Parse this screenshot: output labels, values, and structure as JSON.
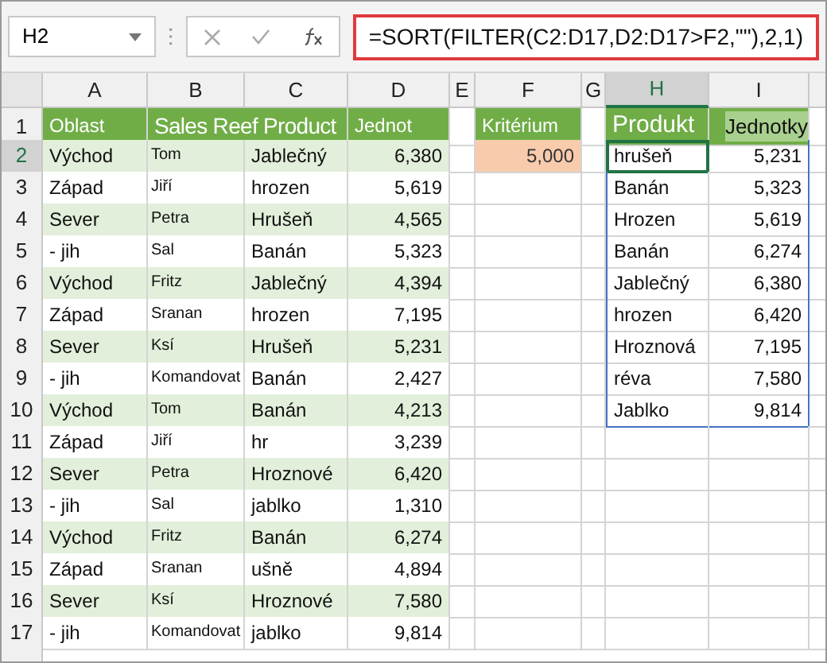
{
  "name_box": "H2",
  "formula": "=SORT(FILTER(C2:D17,D2:D17>F2,\"\"),2,1)",
  "columns": [
    {
      "label": "A",
      "selected": false
    },
    {
      "label": "B",
      "selected": false
    },
    {
      "label": "C",
      "selected": false
    },
    {
      "label": "D",
      "selected": false
    },
    {
      "label": "E",
      "selected": false
    },
    {
      "label": "F",
      "selected": false
    },
    {
      "label": "G",
      "selected": false
    },
    {
      "label": "H",
      "selected": true
    },
    {
      "label": "I",
      "selected": false
    }
  ],
  "row_numbers": [
    "1",
    "2",
    "3",
    "4",
    "5",
    "6",
    "7",
    "8",
    "9",
    "10",
    "11",
    "12",
    "13",
    "14",
    "15",
    "16",
    "17"
  ],
  "sales_table": {
    "header": {
      "region": "Oblast",
      "title": "Sales Reef Product",
      "units": "Jednot"
    },
    "rows": [
      {
        "region": "Východ",
        "name": "Tom",
        "product": "Jablečný",
        "units": "6,380"
      },
      {
        "region": "Západ",
        "name": "Jiří",
        "product": "hrozen",
        "units": "5,619"
      },
      {
        "region": "Sever",
        "name": "Petra",
        "product": "Hrušeň",
        "units": "4,565"
      },
      {
        "region": "- jih",
        "name": "Sal",
        "product": "Banán",
        "units": "5,323"
      },
      {
        "region": "Východ",
        "name": "Fritz",
        "product": "Jablečný",
        "units": "4,394"
      },
      {
        "region": "Západ",
        "name": "Sranan",
        "product": "hrozen",
        "units": "7,195"
      },
      {
        "region": "Sever",
        "name": "Ksí",
        "product": "Hrušeň",
        "units": "5,231"
      },
      {
        "region": "- jih",
        "name": "Komandovat",
        "product": "Banán",
        "units": "2,427"
      },
      {
        "region": "Východ",
        "name": "Tom",
        "product": "Banán",
        "units": "4,213"
      },
      {
        "region": "Západ",
        "name": "Jiří",
        "product": "hr",
        "units": "3,239"
      },
      {
        "region": "Sever",
        "name": "Petra",
        "product": "Hroznové",
        "units": "6,420"
      },
      {
        "region": "- jih",
        "name": "Sal",
        "product": "jablko",
        "units": "1,310"
      },
      {
        "region": "Východ",
        "name": "Fritz",
        "product": "Banán",
        "units": "6,274"
      },
      {
        "region": "Západ",
        "name": "Sranan",
        "product": "ušně",
        "units": "4,894"
      },
      {
        "region": "Sever",
        "name": "Ksí",
        "product": "Hroznové",
        "units": "7,580"
      },
      {
        "region": "- jih",
        "name": "Komandovat",
        "product": "jablko",
        "units": "9,814"
      }
    ]
  },
  "criterion": {
    "label": "Kritérium",
    "value": "5,000"
  },
  "result": {
    "header": {
      "product": "Produkt",
      "units": "Jednotky"
    },
    "rows": [
      {
        "product": "hrušeň",
        "units": "5,231",
        "selected": true
      },
      {
        "product": "Banán",
        "units": "5,323",
        "selected": false
      },
      {
        "product": "Hrozen",
        "units": "5,619",
        "selected": false
      },
      {
        "product": "Banán",
        "units": "6,274",
        "selected": false
      },
      {
        "product": "Jablečný",
        "units": "6,380",
        "selected": false
      },
      {
        "product": "hrozen",
        "units": "6,420",
        "selected": false
      },
      {
        "product": "Hroznová",
        "units": "7,195",
        "selected": false
      },
      {
        "product": "réva",
        "units": "7,580",
        "selected": false
      },
      {
        "product": "Jablko",
        "units": "9,814",
        "selected": false
      }
    ]
  }
}
